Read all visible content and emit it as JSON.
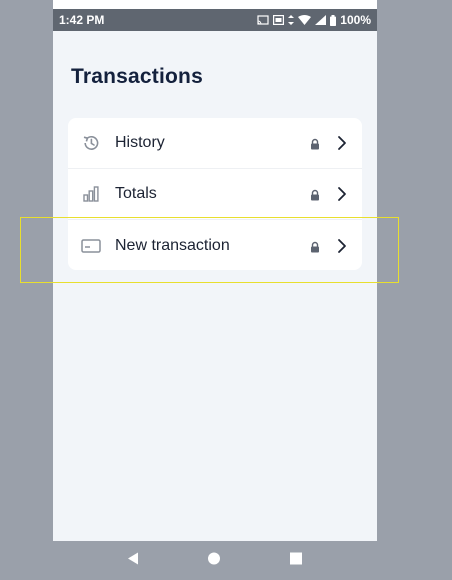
{
  "status_bar": {
    "time": "1:42 PM",
    "battery": "100%",
    "icons": [
      "cast-icon",
      "image-icon",
      "data-arrows-icon",
      "wifi-icon",
      "signal-icon",
      "battery-icon"
    ]
  },
  "page": {
    "title": "Transactions"
  },
  "menu": {
    "items": [
      {
        "label": "History",
        "icon": "history-icon",
        "locked": true
      },
      {
        "label": "Totals",
        "icon": "bar-chart-icon",
        "locked": true
      },
      {
        "label": "New transaction",
        "icon": "credit-card-icon",
        "locked": true
      }
    ]
  },
  "nav_bar": {
    "buttons": [
      "back-icon",
      "home-icon",
      "recents-icon"
    ]
  },
  "colors": {
    "background": "#f2f5f9",
    "title": "#14213d",
    "card": "#ffffff",
    "highlight": "#e8df2e",
    "status_bar": "#5f6670",
    "icon_gray": "#8a909a"
  }
}
